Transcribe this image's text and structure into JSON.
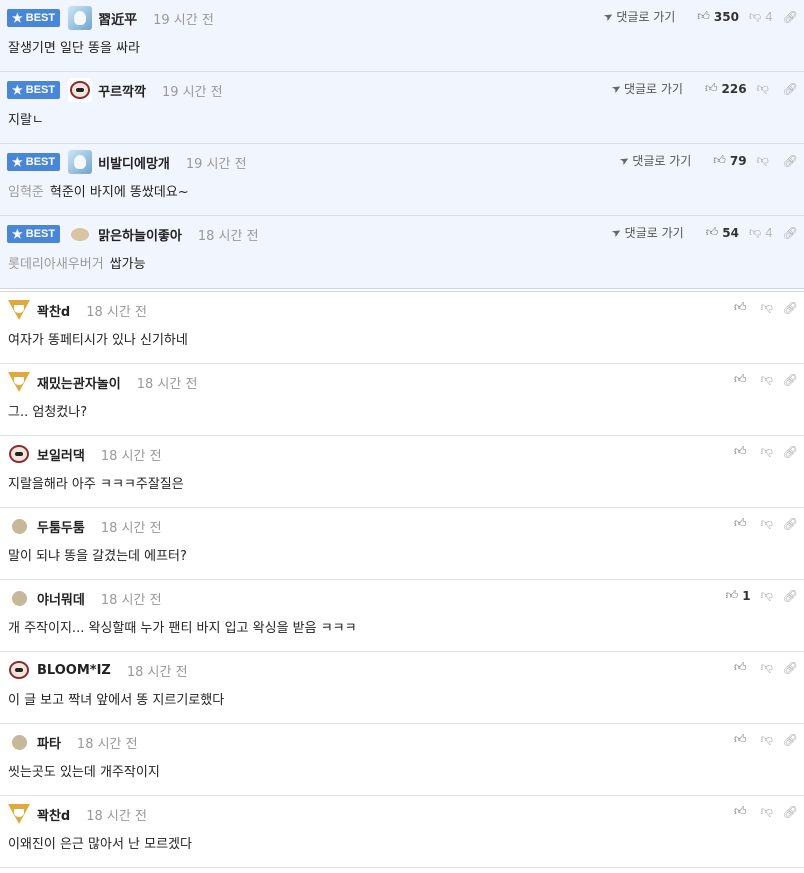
{
  "badge_label": "BEST",
  "reply_label": "댓글로 가기",
  "icons": {
    "badge": "star-icon",
    "reply": "send-arrow-icon",
    "like": "thumbs-up-icon",
    "dislike": "thumbs-down-icon",
    "link": "link-icon"
  },
  "best": [
    {
      "nick": "習近平",
      "time": "19 시간 전",
      "text": "잘생기면 일단 똥을 싸라",
      "prefix": "",
      "likes": "350",
      "dislikes": "4",
      "avatar": "ice"
    },
    {
      "nick": "꾸르깍깍",
      "time": "19 시간 전",
      "text": "지랄ㄴ",
      "prefix": "",
      "likes": "226",
      "dislikes": "",
      "avatar": "dog"
    },
    {
      "nick": "비발디에망개",
      "time": "19 시간 전",
      "text": "혁준이 바지에 똥쌌데요~",
      "prefix": "임혁준",
      "likes": "79",
      "dislikes": "",
      "avatar": "ice"
    },
    {
      "nick": "맑은하늘이좋아",
      "time": "18 시간 전",
      "text": "쌉가능",
      "prefix": "롯데리아새우버거",
      "likes": "54",
      "dislikes": "4",
      "avatar": "blob"
    }
  ],
  "comments": [
    {
      "nick": "꽉찬d",
      "time": "18 시간 전",
      "text": "여자가 똥페티시가 있나 신기하네",
      "likes": "",
      "avatar": "fox"
    },
    {
      "nick": "재밌는관자놀이",
      "time": "18 시간 전",
      "text": "그.. 엄청컸나?",
      "likes": "",
      "avatar": "fox"
    },
    {
      "nick": "보일러댁",
      "time": "18 시간 전",
      "text": "지랄을해라 아주 ㅋㅋㅋ주잘질은",
      "likes": "",
      "avatar": "dog"
    },
    {
      "nick": "두툼두툼",
      "time": "18 시간 전",
      "text": "말이 되냐 똥을 갈겼는데 에프터?",
      "likes": "",
      "avatar": "dot"
    },
    {
      "nick": "야너뭐데",
      "time": "18 시간 전",
      "text": "개 주작이지... 왁싱할때 누가 팬티 바지 입고 왁싱을 받음 ㅋㅋㅋ",
      "likes": "1",
      "avatar": "dot"
    },
    {
      "nick": "BLOOM*IZ",
      "time": "18 시간 전",
      "text": "이 글 보고 짝녀 앞에서 똥 지르기로했다",
      "likes": "",
      "avatar": "dog"
    },
    {
      "nick": "파타",
      "time": "18 시간 전",
      "text": "씻는곳도 있는데 개주작이지",
      "likes": "",
      "avatar": "dot"
    },
    {
      "nick": "꽉찬d",
      "time": "18 시간 전",
      "text": "이왜진이 은근 많아서 난 모르겠다",
      "likes": "",
      "avatar": "fox"
    }
  ]
}
